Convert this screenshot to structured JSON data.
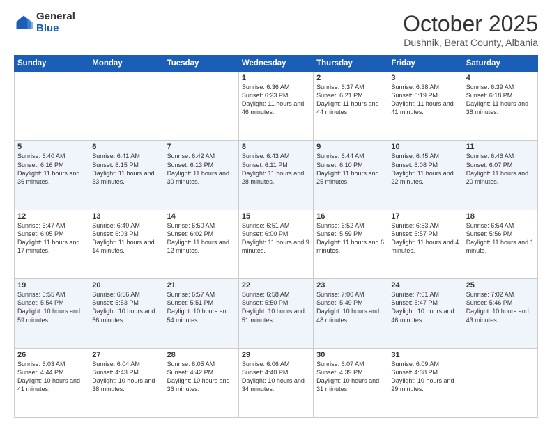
{
  "header": {
    "logo_general": "General",
    "logo_blue": "Blue",
    "month_title": "October 2025",
    "location": "Dushnik, Berat County, Albania"
  },
  "days_of_week": [
    "Sunday",
    "Monday",
    "Tuesday",
    "Wednesday",
    "Thursday",
    "Friday",
    "Saturday"
  ],
  "weeks": [
    [
      {
        "day": "",
        "info": ""
      },
      {
        "day": "",
        "info": ""
      },
      {
        "day": "",
        "info": ""
      },
      {
        "day": "1",
        "info": "Sunrise: 6:36 AM\nSunset: 6:23 PM\nDaylight: 11 hours and 46 minutes."
      },
      {
        "day": "2",
        "info": "Sunrise: 6:37 AM\nSunset: 6:21 PM\nDaylight: 11 hours and 44 minutes."
      },
      {
        "day": "3",
        "info": "Sunrise: 6:38 AM\nSunset: 6:19 PM\nDaylight: 11 hours and 41 minutes."
      },
      {
        "day": "4",
        "info": "Sunrise: 6:39 AM\nSunset: 6:18 PM\nDaylight: 11 hours and 38 minutes."
      }
    ],
    [
      {
        "day": "5",
        "info": "Sunrise: 6:40 AM\nSunset: 6:16 PM\nDaylight: 11 hours and 36 minutes."
      },
      {
        "day": "6",
        "info": "Sunrise: 6:41 AM\nSunset: 6:15 PM\nDaylight: 11 hours and 33 minutes."
      },
      {
        "day": "7",
        "info": "Sunrise: 6:42 AM\nSunset: 6:13 PM\nDaylight: 11 hours and 30 minutes."
      },
      {
        "day": "8",
        "info": "Sunrise: 6:43 AM\nSunset: 6:11 PM\nDaylight: 11 hours and 28 minutes."
      },
      {
        "day": "9",
        "info": "Sunrise: 6:44 AM\nSunset: 6:10 PM\nDaylight: 11 hours and 25 minutes."
      },
      {
        "day": "10",
        "info": "Sunrise: 6:45 AM\nSunset: 6:08 PM\nDaylight: 11 hours and 22 minutes."
      },
      {
        "day": "11",
        "info": "Sunrise: 6:46 AM\nSunset: 6:07 PM\nDaylight: 11 hours and 20 minutes."
      }
    ],
    [
      {
        "day": "12",
        "info": "Sunrise: 6:47 AM\nSunset: 6:05 PM\nDaylight: 11 hours and 17 minutes."
      },
      {
        "day": "13",
        "info": "Sunrise: 6:49 AM\nSunset: 6:03 PM\nDaylight: 11 hours and 14 minutes."
      },
      {
        "day": "14",
        "info": "Sunrise: 6:50 AM\nSunset: 6:02 PM\nDaylight: 11 hours and 12 minutes."
      },
      {
        "day": "15",
        "info": "Sunrise: 6:51 AM\nSunset: 6:00 PM\nDaylight: 11 hours and 9 minutes."
      },
      {
        "day": "16",
        "info": "Sunrise: 6:52 AM\nSunset: 5:59 PM\nDaylight: 11 hours and 6 minutes."
      },
      {
        "day": "17",
        "info": "Sunrise: 6:53 AM\nSunset: 5:57 PM\nDaylight: 11 hours and 4 minutes."
      },
      {
        "day": "18",
        "info": "Sunrise: 6:54 AM\nSunset: 5:56 PM\nDaylight: 11 hours and 1 minute."
      }
    ],
    [
      {
        "day": "19",
        "info": "Sunrise: 6:55 AM\nSunset: 5:54 PM\nDaylight: 10 hours and 59 minutes."
      },
      {
        "day": "20",
        "info": "Sunrise: 6:56 AM\nSunset: 5:53 PM\nDaylight: 10 hours and 56 minutes."
      },
      {
        "day": "21",
        "info": "Sunrise: 6:57 AM\nSunset: 5:51 PM\nDaylight: 10 hours and 54 minutes."
      },
      {
        "day": "22",
        "info": "Sunrise: 6:58 AM\nSunset: 5:50 PM\nDaylight: 10 hours and 51 minutes."
      },
      {
        "day": "23",
        "info": "Sunrise: 7:00 AM\nSunset: 5:49 PM\nDaylight: 10 hours and 48 minutes."
      },
      {
        "day": "24",
        "info": "Sunrise: 7:01 AM\nSunset: 5:47 PM\nDaylight: 10 hours and 46 minutes."
      },
      {
        "day": "25",
        "info": "Sunrise: 7:02 AM\nSunset: 5:46 PM\nDaylight: 10 hours and 43 minutes."
      }
    ],
    [
      {
        "day": "26",
        "info": "Sunrise: 6:03 AM\nSunset: 4:44 PM\nDaylight: 10 hours and 41 minutes."
      },
      {
        "day": "27",
        "info": "Sunrise: 6:04 AM\nSunset: 4:43 PM\nDaylight: 10 hours and 38 minutes."
      },
      {
        "day": "28",
        "info": "Sunrise: 6:05 AM\nSunset: 4:42 PM\nDaylight: 10 hours and 36 minutes."
      },
      {
        "day": "29",
        "info": "Sunrise: 6:06 AM\nSunset: 4:40 PM\nDaylight: 10 hours and 34 minutes."
      },
      {
        "day": "30",
        "info": "Sunrise: 6:07 AM\nSunset: 4:39 PM\nDaylight: 10 hours and 31 minutes."
      },
      {
        "day": "31",
        "info": "Sunrise: 6:09 AM\nSunset: 4:38 PM\nDaylight: 10 hours and 29 minutes."
      },
      {
        "day": "",
        "info": ""
      }
    ]
  ]
}
